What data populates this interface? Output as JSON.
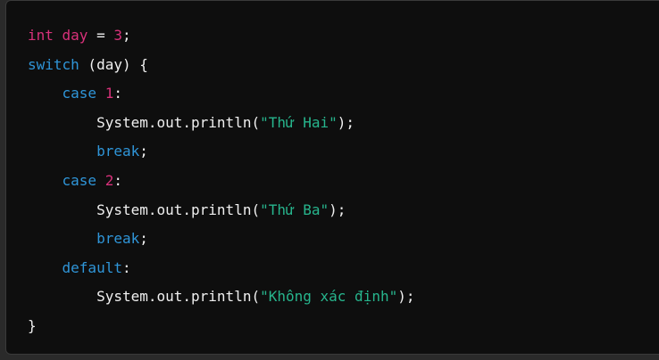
{
  "code": {
    "line1": {
      "type": "int",
      "var": " day ",
      "eq": "=",
      "sp": " ",
      "val": "3",
      "end": ";"
    },
    "line2": {
      "kw": "switch",
      "rest": " (day) {"
    },
    "line3": {
      "indent": "    ",
      "kw": "case",
      "sp": " ",
      "num": "1",
      "colon": ":"
    },
    "line4": {
      "indent": "        ",
      "call": "System.out.println(",
      "str": "\"Thứ Hai\"",
      "end": ");"
    },
    "line5": {
      "indent": "        ",
      "kw": "break",
      "end": ";"
    },
    "line6": {
      "indent": "    ",
      "kw": "case",
      "sp": " ",
      "num": "2",
      "colon": ":"
    },
    "line7": {
      "indent": "        ",
      "call": "System.out.println(",
      "str": "\"Thứ Ba\"",
      "end": ");"
    },
    "line8": {
      "indent": "        ",
      "kw": "break",
      "end": ";"
    },
    "line9": {
      "indent": "    ",
      "kw": "default",
      "colon": ":"
    },
    "line10": {
      "indent": "        ",
      "call": "System.out.println(",
      "str": "\"Không xác định\"",
      "end": ");"
    },
    "line11": {
      "brace": "}"
    }
  },
  "colors": {
    "background": "#0e0e0e",
    "keyword_pink": "#d8317a",
    "keyword_blue": "#2f95d8",
    "string": "#27b58d",
    "text": "#f0f0f0"
  }
}
